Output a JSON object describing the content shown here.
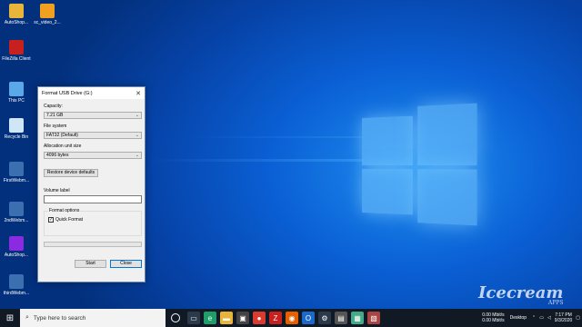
{
  "desktop": {
    "icons": [
      {
        "label": "AutoShop...",
        "icon": "folder-icon",
        "color": "#e8b53a"
      },
      {
        "label": "sc_video_2...",
        "icon": "video-file-icon",
        "color": "#f0a020"
      },
      {
        "label": "FileZilla Client",
        "icon": "filezilla-icon",
        "color": "#c8201e"
      },
      {
        "label": "This PC",
        "icon": "computer-icon",
        "color": "#5aa8e8"
      },
      {
        "label": "Recycle Bin",
        "icon": "recycle-bin-icon",
        "color": "#cfe6f7"
      },
      {
        "label": "FirstWebm...",
        "icon": "webm-file-icon",
        "color": "#3a6fb0"
      },
      {
        "label": "2ndWebm...",
        "icon": "webm-file-icon",
        "color": "#3a6fb0"
      },
      {
        "label": "AutoShop...",
        "icon": "winrar-icon",
        "color": "#8a2be2"
      },
      {
        "label": "thirdWebm...",
        "icon": "webm-file-icon",
        "color": "#3a6fb0"
      }
    ]
  },
  "dialog": {
    "title": "Format USB Drive (G:)",
    "capacity_label": "Capacity:",
    "capacity_value": "7.21 GB",
    "filesystem_label": "File system",
    "filesystem_value": "FAT32 (Default)",
    "allocation_label": "Allocation unit size",
    "allocation_value": "4096 bytes",
    "restore_label": "Restore device defaults",
    "volume_label": "Volume label",
    "volume_value": "",
    "format_options_label": "Format options",
    "quick_format_label": "Quick Format",
    "quick_format_checked": true,
    "start_label": "Start",
    "close_label": "Close"
  },
  "taskbar": {
    "search_placeholder": "Type here to search",
    "apps": [
      {
        "icon": "task-view-icon",
        "glyph": "▭",
        "color": "#2a3a4a"
      },
      {
        "icon": "edge-icon",
        "glyph": "e",
        "color": "#1f9e6a"
      },
      {
        "icon": "file-explorer-icon",
        "glyph": "▬",
        "color": "#e8b53a"
      },
      {
        "icon": "store-icon",
        "glyph": "▣",
        "color": "#444"
      },
      {
        "icon": "chrome-icon",
        "glyph": "●",
        "color": "#d93b2f"
      },
      {
        "icon": "filezilla-icon",
        "glyph": "Z",
        "color": "#c8201e"
      },
      {
        "icon": "firefox-icon",
        "glyph": "◉",
        "color": "#e66000"
      },
      {
        "icon": "outlook-icon",
        "glyph": "O",
        "color": "#1b6ac9"
      },
      {
        "icon": "settings-icon",
        "glyph": "⚙",
        "color": "#2a3a4a"
      },
      {
        "icon": "app-icon",
        "glyph": "▤",
        "color": "#555"
      },
      {
        "icon": "app-icon",
        "glyph": "▦",
        "color": "#4a8"
      },
      {
        "icon": "app-icon",
        "glyph": "▧",
        "color": "#a44"
      }
    ],
    "network_speed_up": "0.00 Mbit/s",
    "network_speed_down": "0.00 Mbit/s",
    "desktop_label": "Desktop",
    "time": "7:17 PM",
    "date": "9/3/2020"
  },
  "watermark": {
    "brand": "Icecream",
    "sub": "APPS"
  }
}
